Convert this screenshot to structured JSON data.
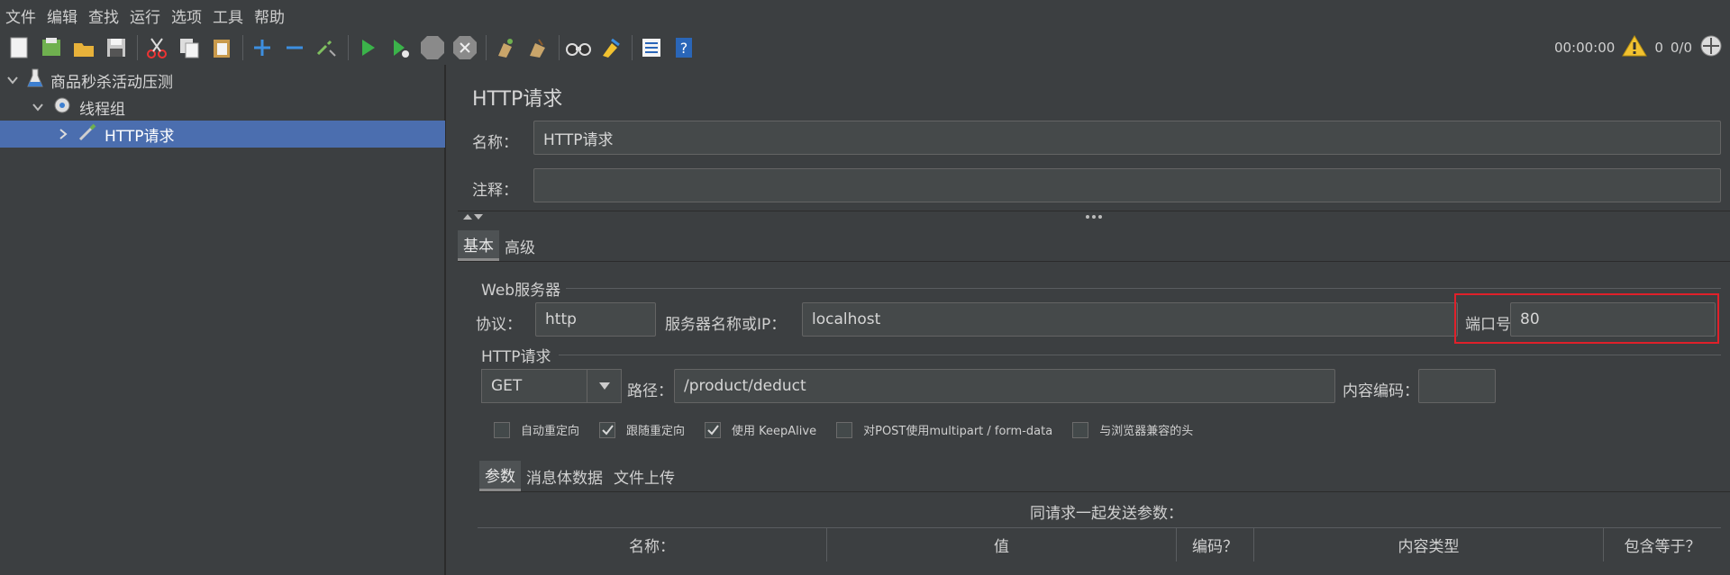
{
  "menu": [
    "文件",
    "编辑",
    "查找",
    "运行",
    "选项",
    "工具",
    "帮助"
  ],
  "toolbar": {
    "icons": [
      "new-icon",
      "templates-icon",
      "open-icon",
      "save-icon",
      "cut-icon",
      "copy-icon",
      "paste-icon",
      "expand-icon",
      "collapse-icon",
      "toggle-icon",
      "start-icon",
      "start-no-pause-icon",
      "stop-icon",
      "shutdown-icon",
      "clear-icon",
      "clear-all-icon",
      "search-icon",
      "reset-search-icon",
      "function-helper-icon",
      "help-icon"
    ],
    "timer": "00:00:00",
    "warnings": "0",
    "threads": "0/0"
  },
  "tree": {
    "plan": "商品秒杀活动压测",
    "thread_group": "线程组",
    "sampler": "HTTP请求"
  },
  "panel": {
    "title": "HTTP请求",
    "name_label": "名称：",
    "name_value": "HTTP请求",
    "comment_label": "注释：",
    "comment_value": "",
    "tabs": [
      "基本",
      "高级"
    ]
  },
  "web_server": {
    "group_title": "Web服务器",
    "protocol_label": "协议：",
    "protocol_value": "http",
    "server_label": "服务器名称或IP：",
    "server_value": "localhost",
    "port_label": "端口号：",
    "port_value": "80"
  },
  "http_request": {
    "group_title": "HTTP请求",
    "method": "GET",
    "path_label": "路径：",
    "path_value": "/product/deduct",
    "encoding_label": "内容编码：",
    "encoding_value": ""
  },
  "options": [
    {
      "label": "自动重定向",
      "checked": false
    },
    {
      "label": "跟随重定向",
      "checked": true
    },
    {
      "label": "使用 KeepAlive",
      "checked": true
    },
    {
      "label": "对POST使用multipart / form-data",
      "checked": false
    },
    {
      "label": "与浏览器兼容的头",
      "checked": false
    }
  ],
  "param_tabs": [
    "参数",
    "消息体数据",
    "文件上传"
  ],
  "params": {
    "caption": "同请求一起发送参数：",
    "columns": [
      "名称：",
      "值",
      "编码？",
      "内容类型",
      "包含等于？"
    ]
  }
}
